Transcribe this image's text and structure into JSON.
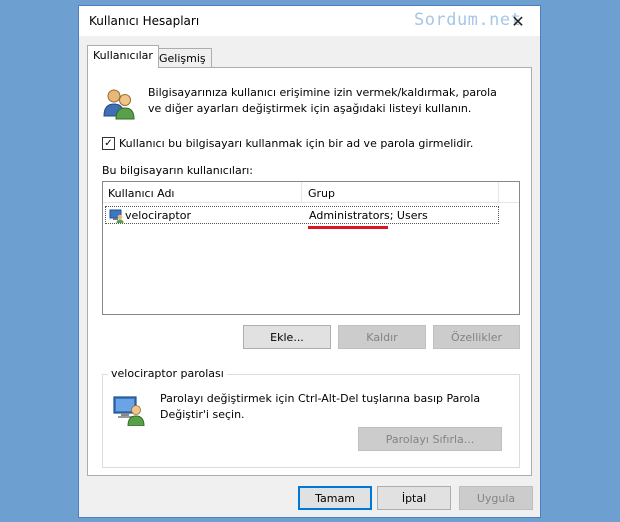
{
  "window": {
    "title": "Kullanıcı Hesapları",
    "watermark": "Sordum.net",
    "close_symbol": "✕"
  },
  "tabs": [
    {
      "label": "Kullanıcılar",
      "active": true
    },
    {
      "label": "Gelişmiş",
      "active": false
    }
  ],
  "intro": {
    "text": "Bilgisayarınıza kullanıcı erişimine izin vermek/kaldırmak, parola ve diğer ayarları değiştirmek için aşağıdaki listeyi kullanın.",
    "icon": "users-icon"
  },
  "checkbox": {
    "label": "Kullanıcı bu bilgisayarı kullanmak için bir ad ve parola girmelidir.",
    "checked": true,
    "mark": "✓"
  },
  "users_list": {
    "label": "Bu bilgisayarın kullanıcıları:",
    "columns": [
      "Kullanıcı Adı",
      "Grup"
    ],
    "rows": [
      {
        "user": "velociraptor",
        "group": "Administrators; Users"
      }
    ]
  },
  "list_buttons": {
    "add": "Ekle...",
    "remove": "Kaldır",
    "properties": "Özellikler"
  },
  "password_group": {
    "title": "velociraptor parolası",
    "text": "Parolayı değiştirmek için Ctrl-Alt-Del tuşlarına basıp Parola Değiştir'i seçin.",
    "reset_button": "Parolayı Sıfırla..."
  },
  "footer": {
    "ok": "Tamam",
    "cancel": "İptal",
    "apply": "Uygula"
  },
  "colors": {
    "accent": "#0078d7",
    "highlight_underline": "#e0141e",
    "background": "#6e9fd1"
  }
}
